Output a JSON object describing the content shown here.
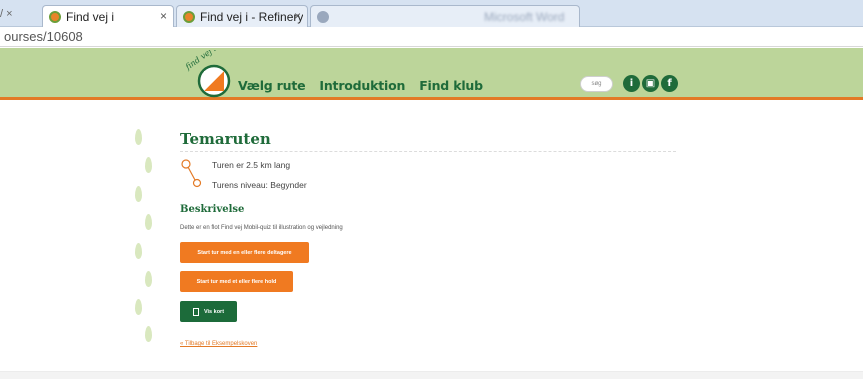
{
  "browser": {
    "prev_tab_fragment": "/ ×",
    "tabs": [
      {
        "label": "Find vej i",
        "close": "×"
      },
      {
        "label": "Find vej i - Refinery",
        "close": "×"
      },
      {
        "label": "Microsoft Word",
        "close": ""
      }
    ],
    "url": "ourses/10608"
  },
  "header": {
    "logo_text": "find vej i ...",
    "nav": [
      "Vælg rute",
      "Introduktion",
      "Find klub"
    ],
    "search_placeholder": "søg",
    "social_icons": [
      "info-icon",
      "camera-icon",
      "facebook-icon"
    ],
    "social_glyphs": [
      "i",
      "▣",
      "f"
    ]
  },
  "content": {
    "title": "Temaruten",
    "length": "Turen er 2.5 km lang",
    "level": "Turens niveau: Begynder",
    "section_title": "Beskrivelse",
    "description": "Dette er en flot Find vej Mobil-quiz til illustration og vejledning",
    "buttons": {
      "start_participants": "Start tur med en eller flere deltagere",
      "start_teams": "Start tur med et eller flere hold",
      "show_map": "Vis kort"
    },
    "back_link": "« Tilbage til Eksempelskoven"
  },
  "colors": {
    "header_green": "#bcd59a",
    "brand_dark_green": "#1f6b3a",
    "accent_orange": "#f07a21"
  }
}
